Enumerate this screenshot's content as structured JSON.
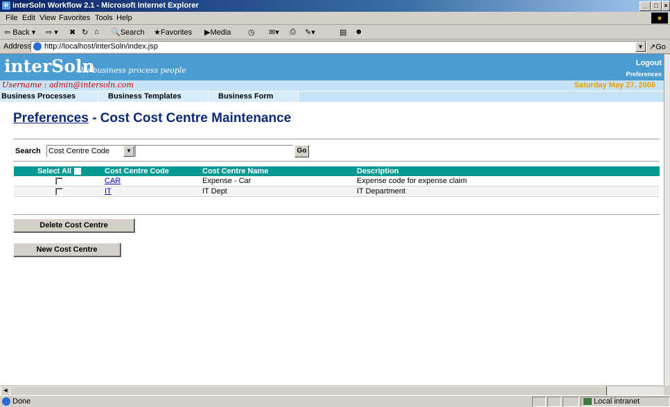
{
  "window": {
    "title": "interSoln Workflow 2.1 - Microsoft Internet Explorer",
    "controls": [
      "_",
      "□",
      "×"
    ]
  },
  "menu": [
    "File",
    "Edit",
    "View",
    "Favorites",
    "Tools",
    "Help"
  ],
  "toolbar": {
    "back": "⇦ Back ▾",
    "forward": "⇨ ▾",
    "search": "Search",
    "favorites": "Favorites",
    "media": "Media"
  },
  "address": {
    "label": "Address",
    "url": "http://localhost/interSoln/index.jsp",
    "go": "Go"
  },
  "app": {
    "logo": "interSoln",
    "tagline": "the business process people",
    "logout": "Logout",
    "preferences": "Preferences",
    "username": "Username : admin@intersoln.com",
    "date": "Saturday May 27, 2006",
    "nav": [
      "Business Processes",
      "Business Templates",
      "Business Form"
    ]
  },
  "page": {
    "title_link": "Preferences",
    "title_rest": " - Cost Cost Centre Maintenance",
    "search_label": "Search",
    "search_field": "Cost Centre Code",
    "search_value": "",
    "go": "Go"
  },
  "table": {
    "headers": [
      "Select All",
      "Cost Centre Code",
      "Cost Centre Name",
      "Description"
    ],
    "rows": [
      {
        "code": "CAR",
        "name": "Expense - Car",
        "description": "Expense code for expense claim"
      },
      {
        "code": "IT",
        "name": "IT Dept",
        "description": "IT Department"
      }
    ]
  },
  "buttons": {
    "delete": "Delete Cost Centre",
    "new": "New Cost Centre"
  },
  "status": {
    "text": "Done",
    "zone": "Local intranet"
  }
}
